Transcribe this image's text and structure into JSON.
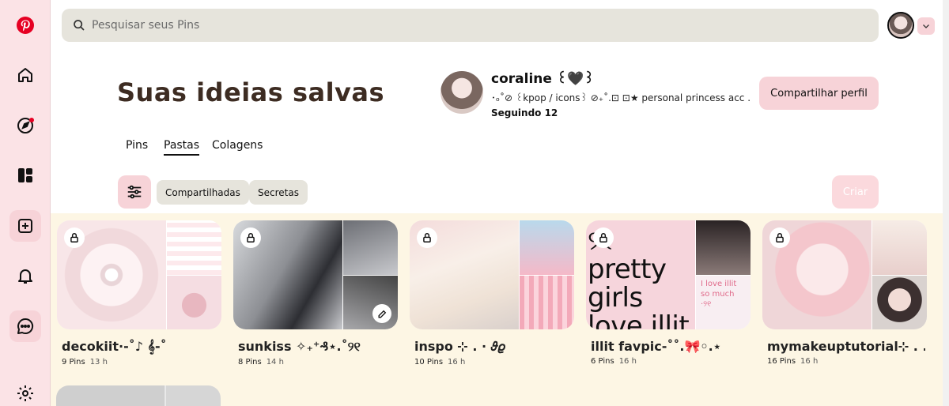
{
  "colors": {
    "sidebar_bg": "#fbe3e6",
    "accent_pink": "#f7d3d8",
    "brand_red": "#e60023",
    "boards_bg": "#fdf6e4",
    "title_brown": "#3d2c22"
  },
  "search": {
    "placeholder": "Pesquisar seus Pins"
  },
  "sidebar": {
    "icons": [
      "pinterest-logo-icon",
      "home-icon",
      "explore-icon",
      "boards-icon",
      "create-icon",
      "notifications-icon",
      "messages-icon",
      "settings-icon"
    ]
  },
  "page": {
    "title": "Suas ideias salvas"
  },
  "profile": {
    "name": "coraline ꒰🖤꒱",
    "bio": "･ₒ˚⊘ ꒰kpop / icons꒱ ⊘₊˚.⊡ ⊡★ personal princess acc .",
    "following": "Seguindo 12",
    "share_label": "Compartilhar perfil"
  },
  "tabs": [
    {
      "label": "Pins"
    },
    {
      "label": "Pastas"
    },
    {
      "label": "Colagens"
    }
  ],
  "filters": {
    "shared_label": "Compartilhadas",
    "secret_label": "Secretas",
    "create_label": "Criar"
  },
  "boards": [
    {
      "title": "decokiit·-˚♪ 𝄞-˚",
      "pins": "9 Pins",
      "time": "13 h"
    },
    {
      "title": "sunkiss ✧₊⁺₰⋆.˚୨୧",
      "pins": "8 Pins",
      "time": "14 h"
    },
    {
      "title": "inspo ⊹ . ⋅ 𝜗𝜚",
      "pins": "10 Pins",
      "time": "16 h"
    },
    {
      "title": "illit favpic-˚˚.🎀◦.⋆",
      "pins": "6 Pins",
      "time": "16 h"
    },
    {
      "title": "mymakeuptutorial⊹ . .",
      "pins": "16 Pins",
      "time": "16 h"
    }
  ],
  "board_texts": {
    "pretty": "୨୧ pretty girls love illit",
    "love": "I love illit so much ·୨୧"
  }
}
